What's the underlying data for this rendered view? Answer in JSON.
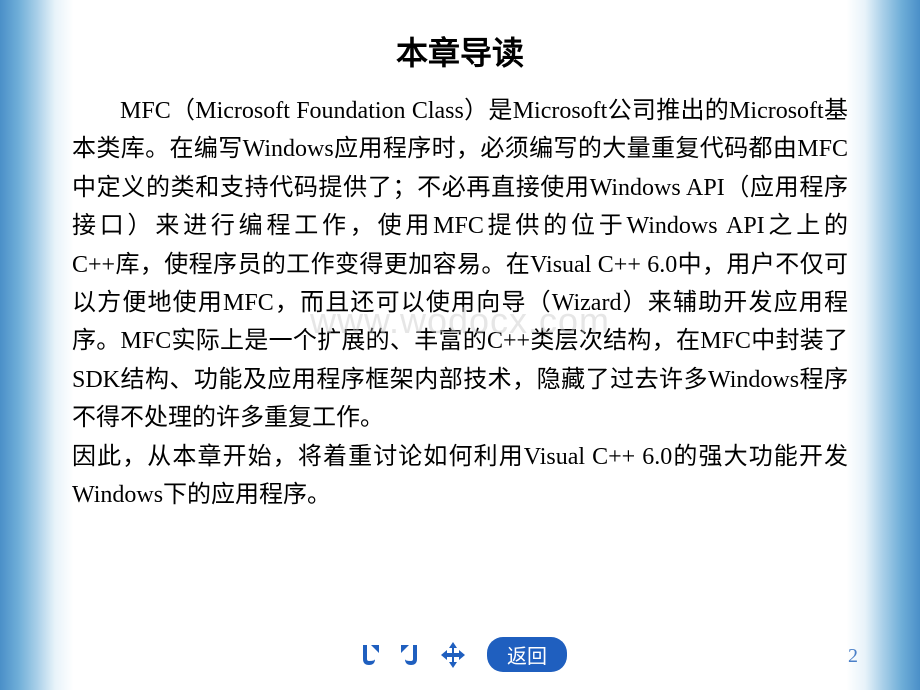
{
  "slide": {
    "title": "本章导读",
    "paragraph1": "MFC（Microsoft Foundation Class）是Microsoft公司推出的Microsoft基本类库。在编写Windows应用程序时，必须编写的大量重复代码都由MFC中定义的类和支持代码提供了；不必再直接使用Windows API（应用程序接口）来进行编程工作，使用MFC提供的位于Windows API之上的C++库，使程序员的工作变得更加容易。在Visual C++ 6.0中，用户不仅可以方便地使用MFC，而且还可以使用向导（Wizard）来辅助开发应用程序。MFC实际上是一个扩展的、丰富的C++类层次结构，在MFC中封装了SDK结构、功能及应用程序框架内部技术，隐藏了过去许多Windows程序不得不处理的许多重复工作。",
    "paragraph2": "因此，从本章开始，将着重讨论如何利用Visual C++ 6.0的强大功能开发Windows下的应用程序。",
    "watermark": "www.wodocx.com"
  },
  "nav": {
    "return_label": "返回"
  },
  "page_number": "2"
}
